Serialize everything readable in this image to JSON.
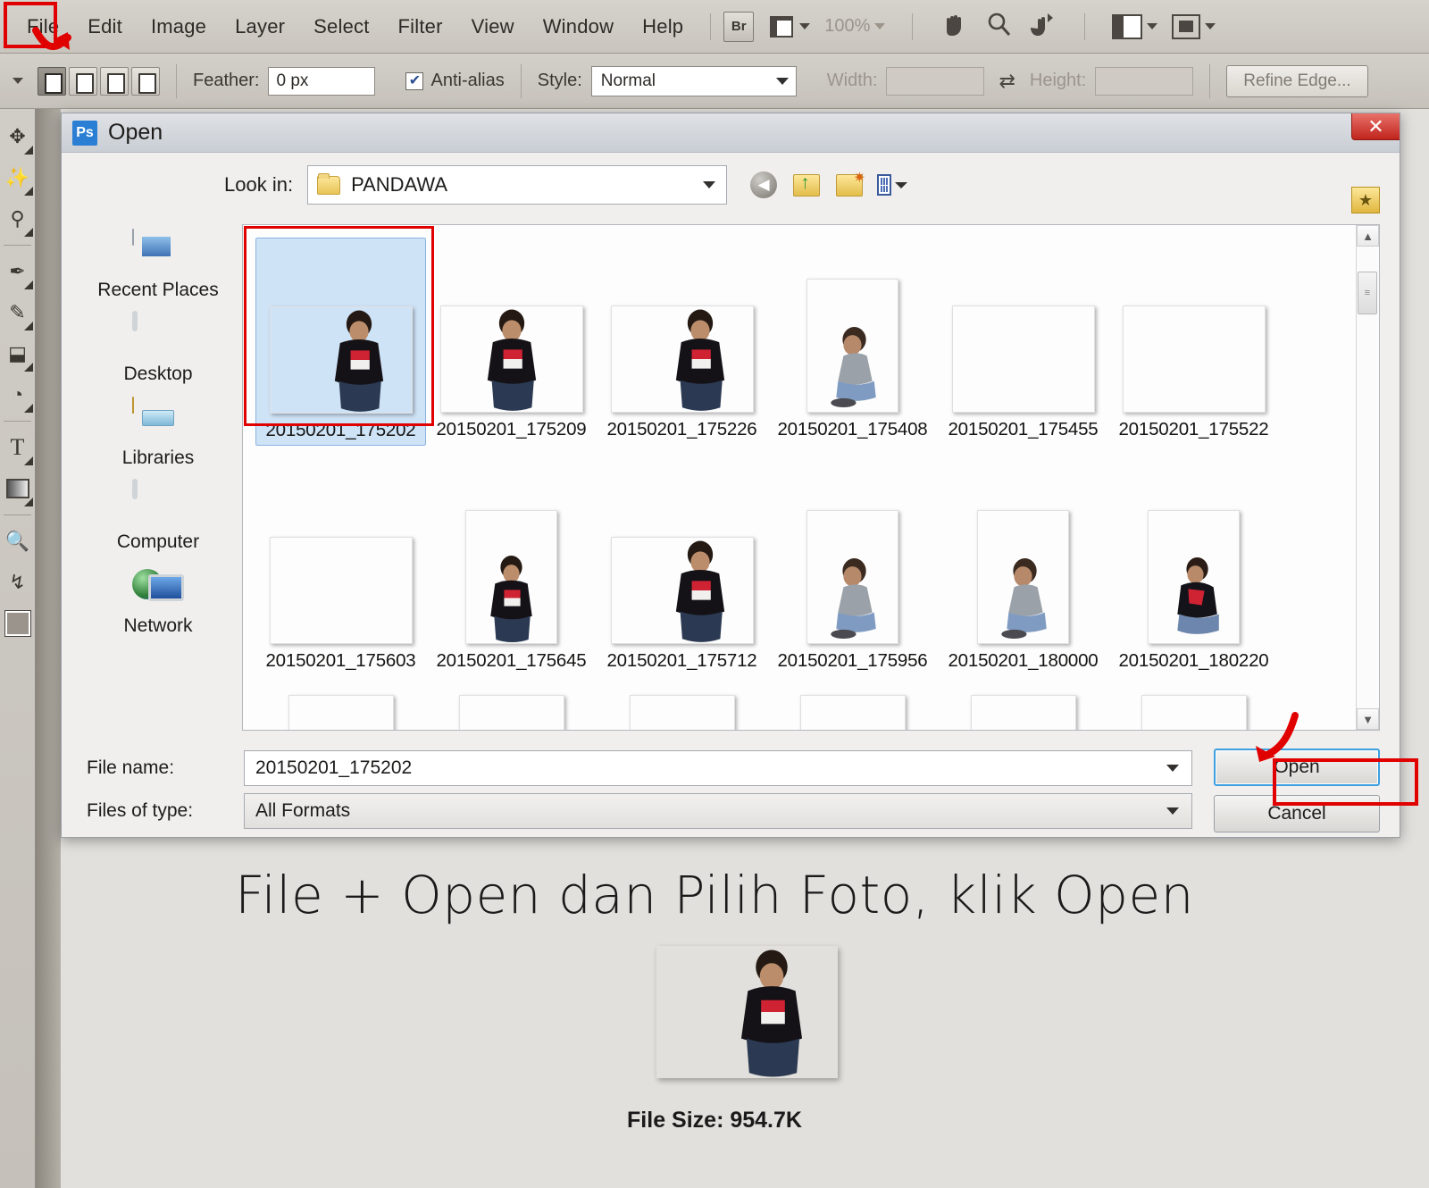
{
  "app": {
    "menu": [
      "File",
      "Edit",
      "Image",
      "Layer",
      "Select",
      "Filter",
      "View",
      "Window",
      "Help"
    ],
    "toolbar": {
      "bridge_label": "Br",
      "zoom_level": "100%",
      "icons": [
        "bridge-icon",
        "mini-bridge-icon",
        "hand-icon",
        "zoom-icon",
        "rotate-view-icon",
        "arrange-documents-icon",
        "screen-mode-icon"
      ]
    },
    "options": {
      "feather_label": "Feather:",
      "feather_value": "0 px",
      "antialias_label": "Anti-alias",
      "antialias_checked": true,
      "style_label": "Style:",
      "style_value": "Normal",
      "width_label": "Width:",
      "width_value": "",
      "height_label": "Height:",
      "height_value": "",
      "refine_edge_label": "Refine Edge..."
    },
    "tools": [
      "move-tool",
      "magic-wand-tool",
      "eyedropper-tool",
      "brush-tool",
      "healing-brush-tool",
      "paint-bucket-tool",
      "blur-tool",
      "type-tool",
      "gradient-tool",
      "zoom-tool",
      "rotate-tool",
      "foreground-color"
    ]
  },
  "dialog": {
    "title": "Open",
    "app_badge": "Ps",
    "close_label": "✕",
    "lookin_label": "Look in:",
    "lookin_value": "PANDAWA",
    "nav_icons": [
      "back-icon",
      "up-one-level-icon",
      "create-new-folder-icon",
      "views-icon",
      "help-star-icon"
    ],
    "places": [
      {
        "label": "Recent Places",
        "icon": "recent-places-icon"
      },
      {
        "label": "Desktop",
        "icon": "desktop-icon"
      },
      {
        "label": "Libraries",
        "icon": "libraries-icon"
      },
      {
        "label": "Computer",
        "icon": "computer-icon"
      },
      {
        "label": "Network",
        "icon": "network-icon"
      }
    ],
    "files": [
      [
        {
          "name": "20150201_175202",
          "selected": true,
          "orient": "landscape"
        },
        {
          "name": "20150201_175209",
          "selected": false,
          "orient": "landscape"
        },
        {
          "name": "20150201_175226",
          "selected": false,
          "orient": "landscape"
        },
        {
          "name": "20150201_175408",
          "selected": false,
          "orient": "portrait"
        },
        {
          "name": "20150201_175455",
          "selected": false,
          "orient": "landscape"
        },
        {
          "name": "20150201_175522",
          "selected": false,
          "orient": "landscape"
        }
      ],
      [
        {
          "name": "20150201_175603",
          "selected": false,
          "orient": "landscape"
        },
        {
          "name": "20150201_175645",
          "selected": false,
          "orient": "portrait"
        },
        {
          "name": "20150201_175712",
          "selected": false,
          "orient": "landscape"
        },
        {
          "name": "20150201_175956",
          "selected": false,
          "orient": "portrait"
        },
        {
          "name": "20150201_180000",
          "selected": false,
          "orient": "portrait"
        },
        {
          "name": "20150201_180220",
          "selected": false,
          "orient": "portrait"
        }
      ]
    ],
    "filename_label": "File name:",
    "filename_value": "20150201_175202",
    "filetype_label": "Files of type:",
    "filetype_value": "All Formats",
    "open_button": "Open",
    "cancel_button": "Cancel",
    "scroll_up": "▲",
    "scroll_down": "▼"
  },
  "annotation": {
    "caption": "File + Open dan Pilih Foto, klik Open",
    "file_size": "File Size: 954.7K",
    "highlight_color": "#e00000"
  }
}
